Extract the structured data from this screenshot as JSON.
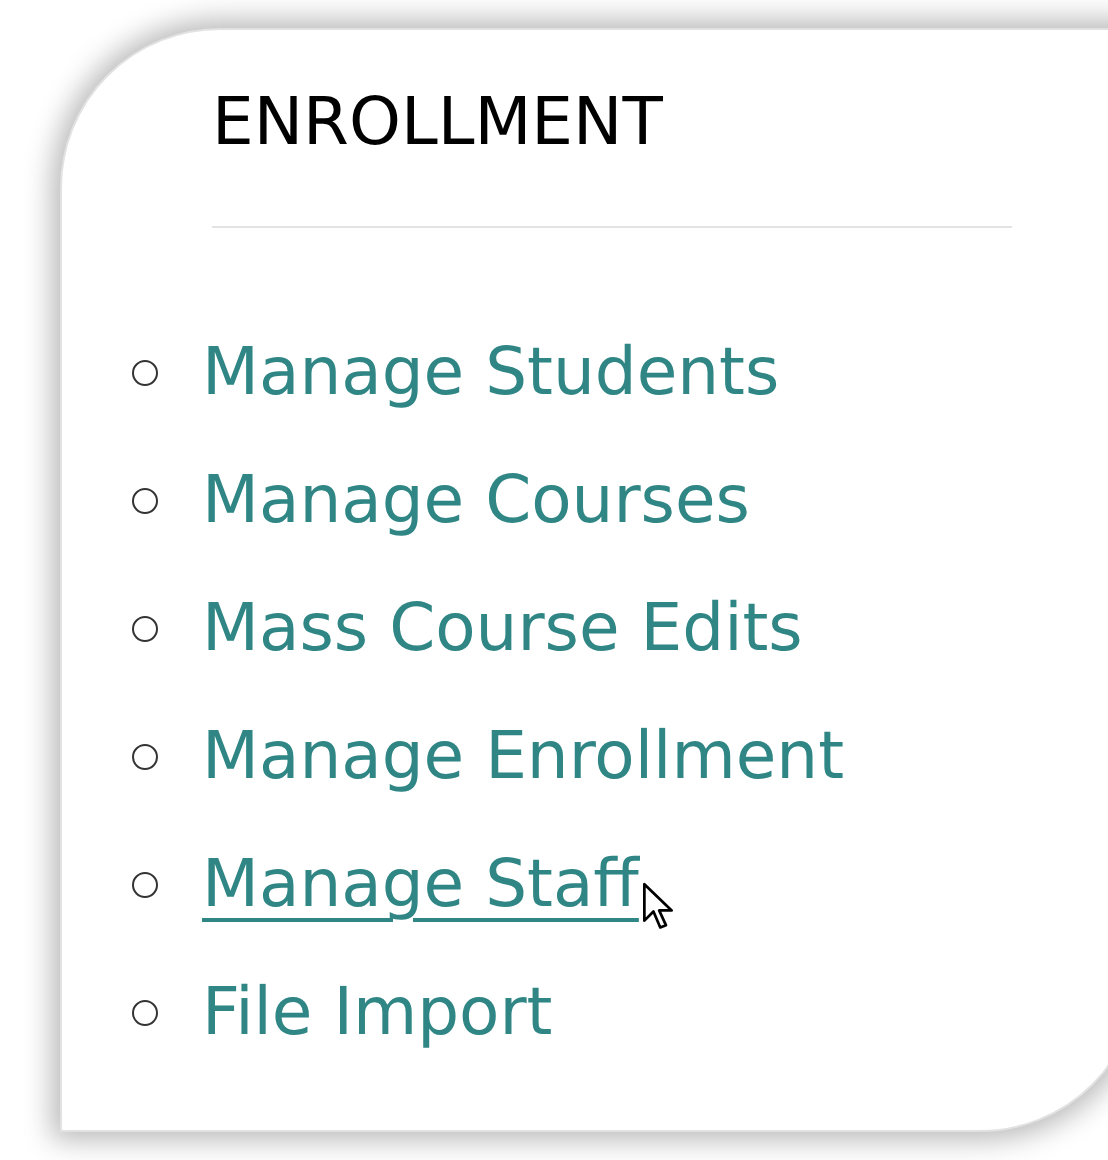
{
  "section": {
    "title": "ENROLLMENT"
  },
  "links": [
    {
      "label": "Manage Students",
      "hovered": false
    },
    {
      "label": "Manage Courses",
      "hovered": false
    },
    {
      "label": "Mass Course Edits",
      "hovered": false
    },
    {
      "label": "Manage Enrollment",
      "hovered": false
    },
    {
      "label": "Manage Staff",
      "hovered": true
    },
    {
      "label": "File Import",
      "hovered": false
    }
  ]
}
